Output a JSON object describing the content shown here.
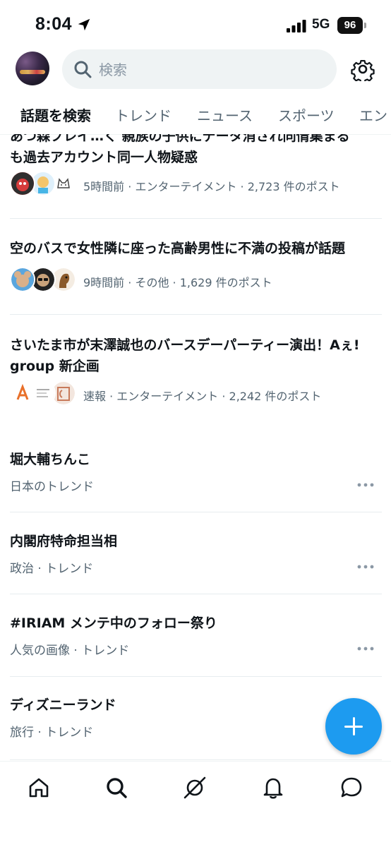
{
  "status_bar": {
    "time": "8:04",
    "network": "5G",
    "battery": "96"
  },
  "search": {
    "placeholder": "検索"
  },
  "tabs": [
    {
      "label": "話題を検索",
      "active": true
    },
    {
      "label": "トレンド"
    },
    {
      "label": "ニュース"
    },
    {
      "label": "スポーツ"
    },
    {
      "label": "エン"
    }
  ],
  "news": [
    {
      "title": "あつ森プレイ… く 親族の子供にデータ消され同情集まる も過去アカウント同一人物疑惑",
      "title_partial_top": "あつ森プレイ…く 親族の子供にデータ消され同情集まる",
      "title_bottom": "も過去アカウント同一人物疑惑",
      "meta": "5時間前 · エンターテイメント · 2,723 件のポスト"
    },
    {
      "title": "空のバスで女性隣に座った高齢男性に不満の投稿が話題",
      "meta": "9時間前 · その他 · 1,629 件のポスト"
    },
    {
      "title": "さいたま市が末澤誠也のバースデーパーティー演出！Aぇ! group 新企画",
      "meta": "速報 · エンターテイメント · 2,242 件のポスト"
    }
  ],
  "trends": [
    {
      "title": "堀大輔ちんこ",
      "subtitle": "日本のトレンド"
    },
    {
      "title": "内閣府特命担当相",
      "subtitle": "政治 · トレンド"
    },
    {
      "title": "#IRIAM メンテ中のフォロー祭り",
      "subtitle": "人気の画像 · トレンド"
    },
    {
      "title": "ディズニーランド",
      "subtitle": "旅行 · トレンド"
    }
  ],
  "bottom_nav": [
    {
      "icon": "home-icon"
    },
    {
      "icon": "search-icon"
    },
    {
      "icon": "grok-icon"
    },
    {
      "icon": "bell-icon"
    },
    {
      "icon": "messages-icon"
    }
  ],
  "colors": {
    "accent": "#1d9bf0",
    "text": "#0f1419",
    "secondary": "#536471"
  }
}
